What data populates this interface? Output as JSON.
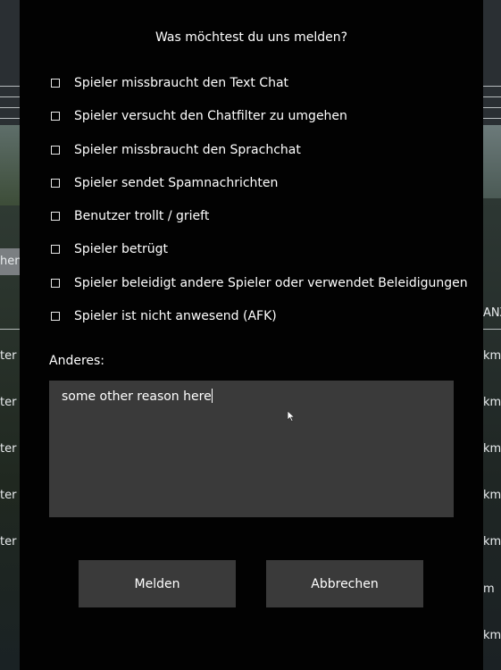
{
  "dialog": {
    "title": "Was möchtest du uns melden?",
    "options": [
      {
        "label": "Spieler missbraucht den Text Chat",
        "checked": false
      },
      {
        "label": "Spieler versucht den Chatfilter zu umgehen",
        "checked": false
      },
      {
        "label": "Spieler missbraucht den Sprachchat",
        "checked": false
      },
      {
        "label": "Spieler sendet Spamnachrichten",
        "checked": false
      },
      {
        "label": "Benutzer trollt / grieft",
        "checked": false
      },
      {
        "label": "Spieler betrügt",
        "checked": false
      },
      {
        "label": "Spieler beleidigt andere Spieler oder verwendet Beleidigungen",
        "checked": false
      },
      {
        "label": "Spieler ist nicht anwesend (AFK)",
        "checked": false
      }
    ],
    "other_label": "Anderes:",
    "other_value": "some other reason here",
    "submit_label": "Melden",
    "cancel_label": "Abbrechen"
  },
  "background": {
    "left_rows": [
      "hen",
      "ter",
      "ter",
      "ter",
      "ter",
      "ter"
    ],
    "right_rows": [
      "ANZ",
      "km",
      "km",
      "km",
      "km",
      "km",
      "m",
      "km"
    ]
  },
  "colors": {
    "dialog_bg": "#020202",
    "field_bg": "#3a3a3a",
    "text": "#ffffff"
  }
}
